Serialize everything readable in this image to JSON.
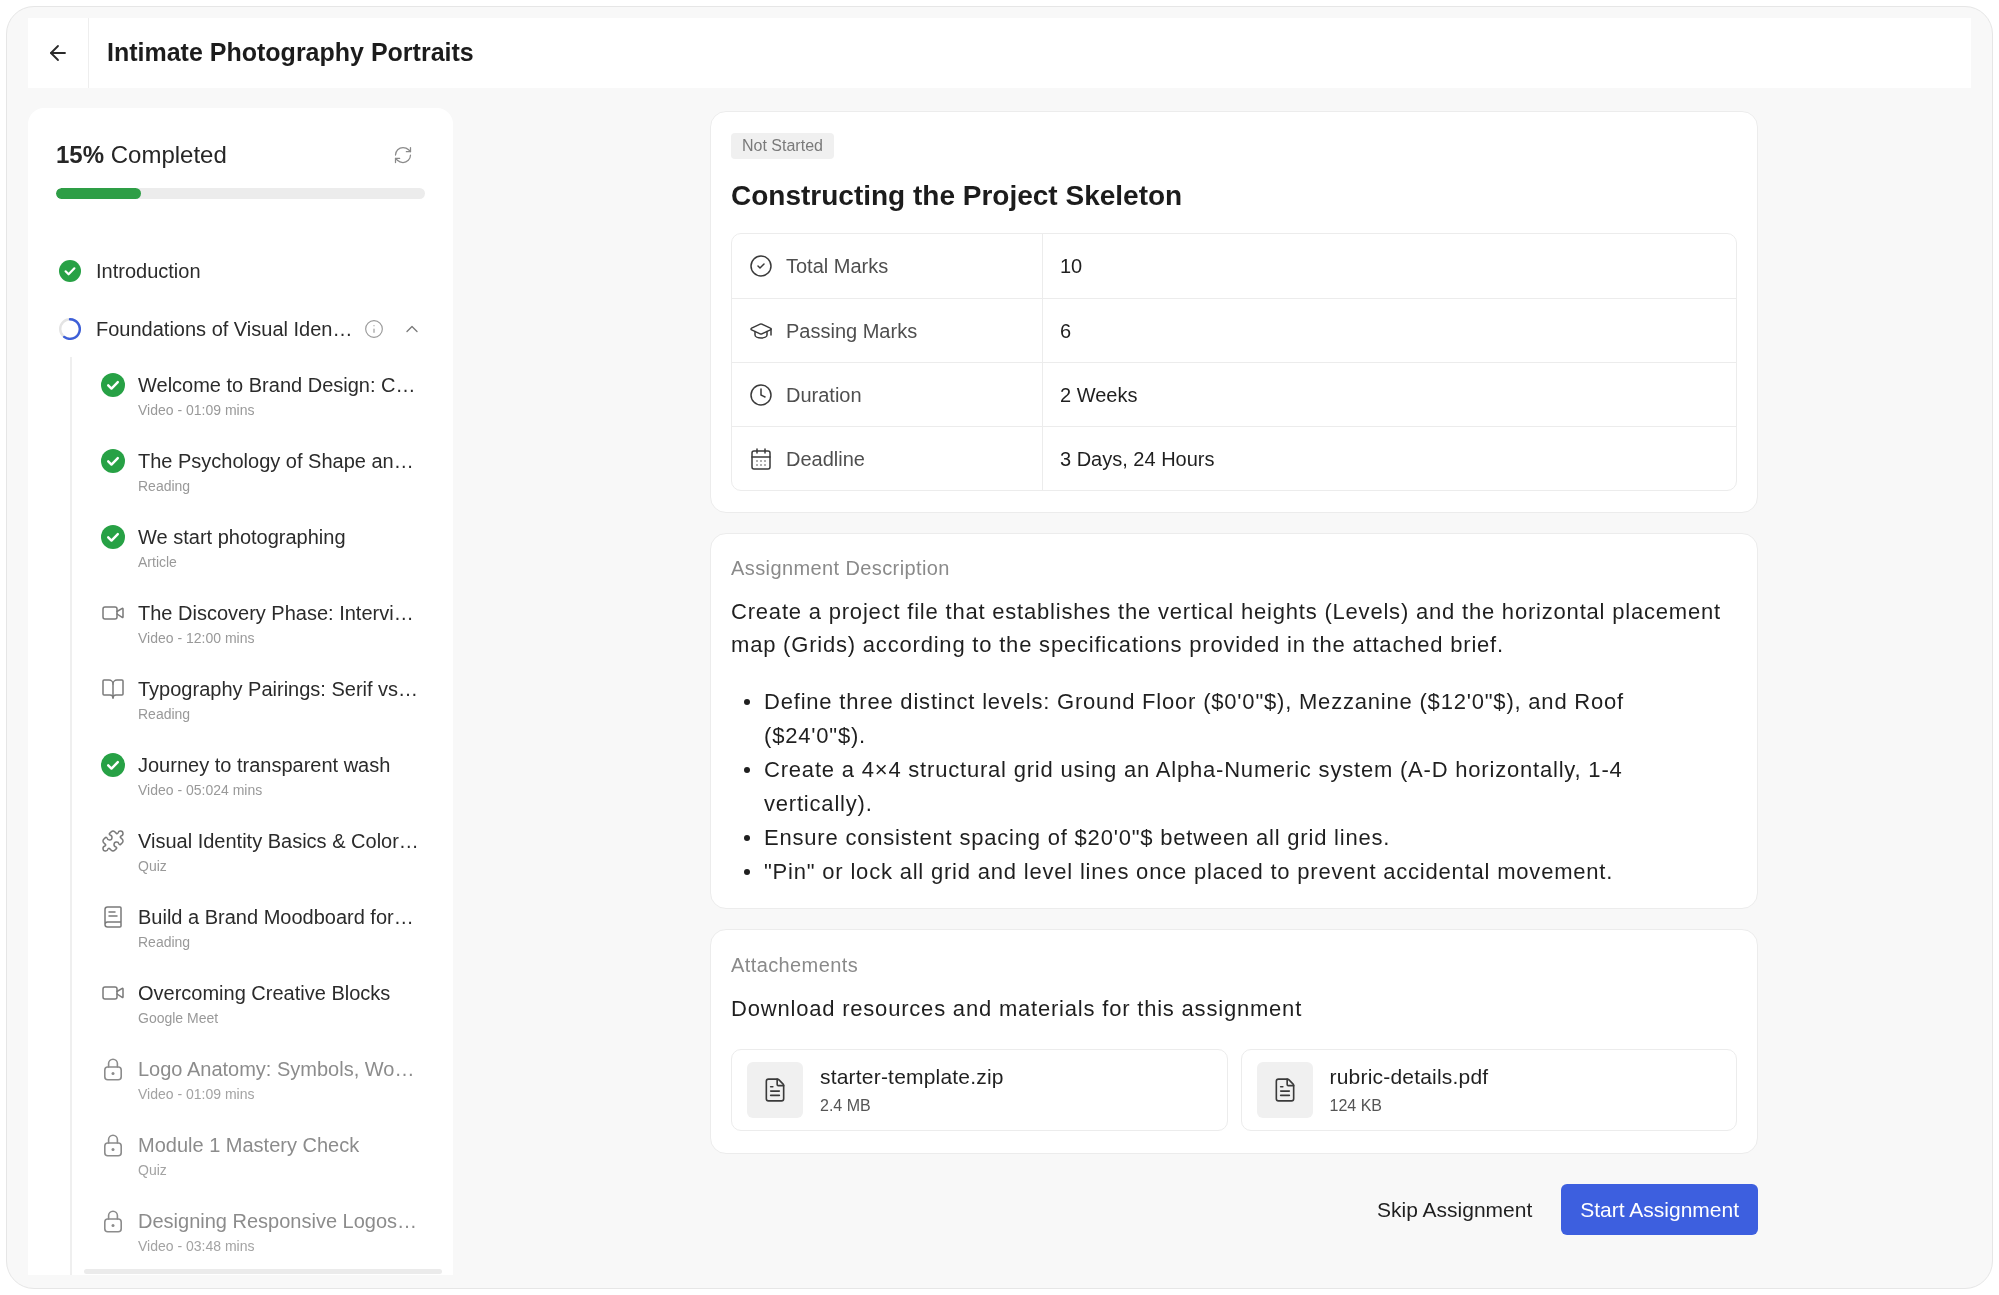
{
  "header": {
    "title": "Intimate Photography Portraits"
  },
  "sidebar": {
    "progress": {
      "label": "**15%** Completed",
      "level": 0.23
    },
    "modules": [
      {
        "title": "Introduction",
        "kind": "completed"
      },
      {
        "title": "Foundations of Visual Iden…",
        "kind": "in_progress",
        "expanded": true,
        "children": [
          {
            "title": "Welcome to Brand Design: C…",
            "subtitle": "Video - 01:09 mins",
            "kind": "completed"
          },
          {
            "title": "The Psychology of Shape an…",
            "subtitle": "Reading",
            "kind": "completed"
          },
          {
            "title": "We start photographing",
            "subtitle": "Article",
            "kind": "completed"
          },
          {
            "title": "The Discovery Phase: Intervi…",
            "subtitle": "Video - 12:00 mins",
            "kind": "video"
          },
          {
            "title": "Typography Pairings: Serif vs…",
            "subtitle": "Reading",
            "kind": "reading"
          },
          {
            "title": "Journey to transparent wash",
            "subtitle": "Video - 05:024 mins",
            "kind": "completed"
          },
          {
            "title": "Visual Identity Basics & Color…",
            "subtitle": "Quiz",
            "kind": "quiz"
          },
          {
            "title": "Build a Brand Moodboard for…",
            "subtitle": "Reading",
            "kind": "document"
          },
          {
            "title": "Overcoming Creative Blocks",
            "subtitle": "Google Meet",
            "kind": "video"
          },
          {
            "title": "Logo Anatomy: Symbols, Wo…",
            "subtitle": "Video - 01:09 mins",
            "kind": "locked"
          },
          {
            "title": "Module 1 Mastery Check",
            "subtitle": "Quiz",
            "kind": "locked"
          },
          {
            "title": "Designing Responsive Logos…",
            "subtitle": "Video - 03:48 mins",
            "kind": "locked"
          }
        ]
      }
    ]
  },
  "assignment": {
    "status": "Not Started",
    "title": "Constructing the Project Skeleton",
    "details": [
      {
        "kind": "marks",
        "label": "Total Marks",
        "value": "10"
      },
      {
        "kind": "passing",
        "label": "Passing Marks",
        "value": "6"
      },
      {
        "kind": "duration",
        "label": "Duration",
        "value": "2 Weeks"
      },
      {
        "kind": "deadline",
        "label": "Deadline",
        "value": "3 Days, 24 Hours"
      }
    ]
  },
  "description": {
    "heading": "Assignment Description",
    "paragraph": "Create a project file that establishes the vertical heights (Levels) and the horizontal placement map (Grids) according to the specifications provided in the attached brief.",
    "bullets": [
      "Define three distinct levels: Ground Floor ($0'0\"$), Mezzanine ($12'0\"$), and Roof ($24'0\"$).",
      "Create a 4×4 structural grid using an Alpha-Numeric system (A-D horizontally, 1-4 vertically).",
      "Ensure consistent spacing of $20'0\"$ between all grid lines.",
      "\"Pin\" or lock all grid and level lines once placed to prevent accidental movement."
    ]
  },
  "attachments": {
    "heading": "Attachements",
    "subtitle": "Download resources and materials for this assignment",
    "files": [
      {
        "name": "starter-template.zip",
        "size": "2.4 MB"
      },
      {
        "name": "rubric-details.pdf",
        "size": "124 KB"
      }
    ]
  },
  "actions": [
    {
      "label": "Skip Assignment",
      "kind": "secondary"
    },
    {
      "label": "Start Assignment",
      "kind": "primary"
    }
  ]
}
